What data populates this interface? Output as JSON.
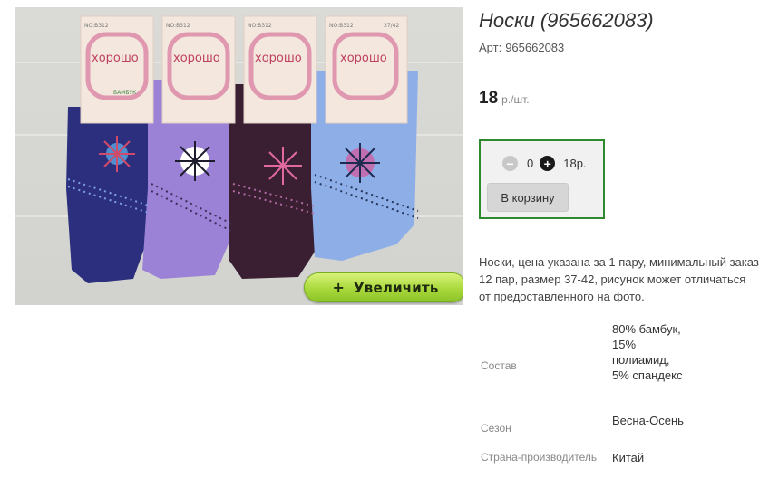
{
  "product": {
    "title": "Носки (965662083)",
    "article_label": "Арт:",
    "article_value": "965662083",
    "price_value": "18",
    "price_unit": "р./шт."
  },
  "image": {
    "zoom_button_label": "Увеличить",
    "zoom_button_icon": "+",
    "package_brand": "хорошо",
    "package_code": "NO:B312",
    "package_size": "37/42",
    "package_material": "БАМБУК",
    "sock_colors": [
      "#2b2f7d",
      "#9b82d6",
      "#3a1f33",
      "#8eaee8"
    ]
  },
  "cart": {
    "minus_icon": "−",
    "quantity": "0",
    "plus_icon": "+",
    "total": "18р.",
    "add_button_label": "В корзину",
    "border_color": "#2f8a2f"
  },
  "description": "Носки, цена указана за 1 пару, минимальный заказ 12 пар, размер 37-42, рисунок может отличаться от предоставленного на фото.",
  "specs": [
    {
      "key": "Состав",
      "value": "80% бамбук, 15% полиамид, 5% спандекс"
    },
    {
      "key": "Сезон",
      "value": "Весна-Осень"
    },
    {
      "key": "Страна-производитель",
      "value": "Китай"
    }
  ]
}
